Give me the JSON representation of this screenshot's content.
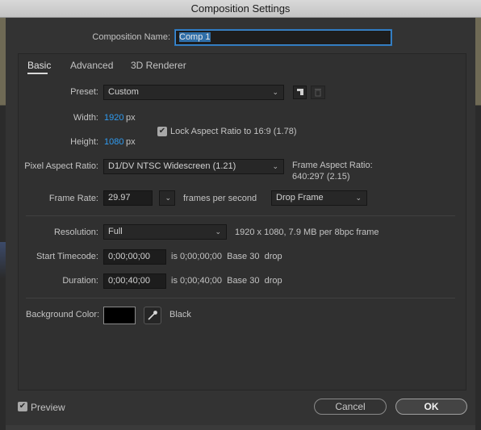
{
  "window": {
    "title": "Composition Settings"
  },
  "comp_name": {
    "label": "Composition Name:",
    "value": "Comp 1"
  },
  "tabs": [
    {
      "label": "Basic"
    },
    {
      "label": "Advanced"
    },
    {
      "label": "3D Renderer"
    }
  ],
  "preset": {
    "label": "Preset:",
    "value": "Custom"
  },
  "width": {
    "label": "Width:",
    "value": "1920",
    "unit": "px"
  },
  "height": {
    "label": "Height:",
    "value": "1080",
    "unit": "px"
  },
  "lock_aspect": {
    "label": "Lock Aspect Ratio to 16:9 (1.78)",
    "checked": true
  },
  "pixel_aspect": {
    "label": "Pixel Aspect Ratio:",
    "value": "D1/DV NTSC Widescreen (1.21)"
  },
  "frame_aspect": {
    "label": "Frame Aspect Ratio:",
    "value": "640:297 (2.15)"
  },
  "frame_rate": {
    "label": "Frame Rate:",
    "value": "29.97",
    "unit": "frames per second",
    "drop_frame": "Drop Frame"
  },
  "resolution": {
    "label": "Resolution:",
    "value": "Full",
    "info": "1920 x 1080, 7.9 MB per 8bpc frame"
  },
  "start_timecode": {
    "label": "Start Timecode:",
    "value": "0;00;00;00",
    "info": "is 0;00;00;00  Base 30  drop"
  },
  "duration": {
    "label": "Duration:",
    "value": "0;00;40;00",
    "info": "is 0;00;40;00  Base 30  drop"
  },
  "background": {
    "label": "Background Color:",
    "color": "#000000",
    "name": "Black"
  },
  "footer": {
    "preview_label": "Preview",
    "preview_checked": true,
    "cancel_label": "Cancel",
    "ok_label": "OK"
  }
}
